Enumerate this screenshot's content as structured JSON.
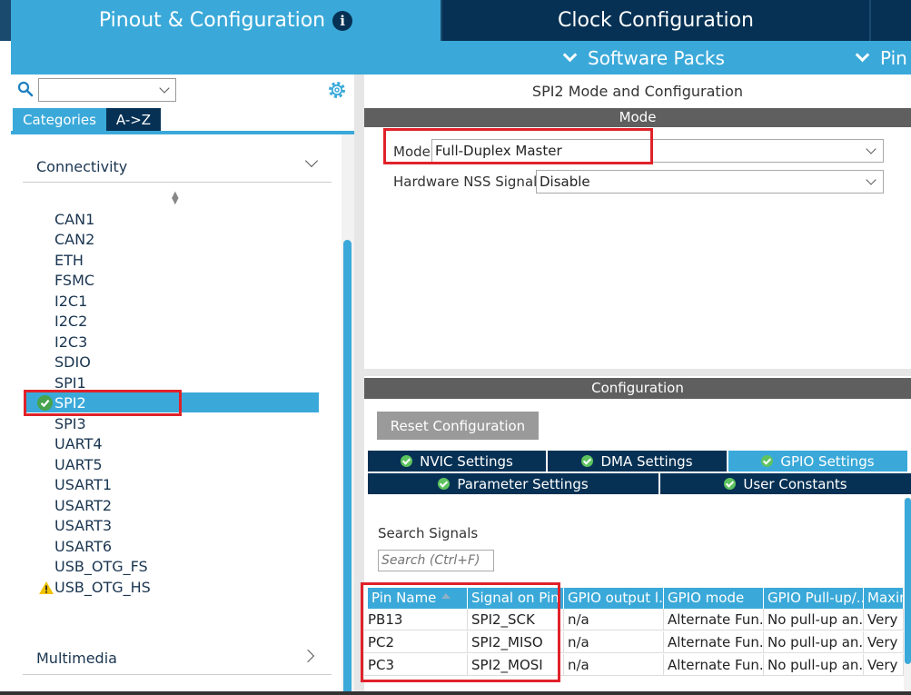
{
  "top_tabs": {
    "pinout": "Pinout & Configuration",
    "clock": "Clock Configuration",
    "info_icon": "i"
  },
  "sub_bar": {
    "software_packs": "Software Packs",
    "pin": "Pin"
  },
  "left": {
    "search_value": "",
    "tabs": [
      "Categories",
      "A->Z"
    ],
    "sections": {
      "connectivity": "Connectivity",
      "multimedia": "Multimedia"
    },
    "peripherals": [
      "CAN1",
      "CAN2",
      "ETH",
      "FSMC",
      "I2C1",
      "I2C2",
      "I2C3",
      "SDIO",
      "SPI1",
      "SPI2",
      "SPI3",
      "UART4",
      "UART5",
      "USART1",
      "USART2",
      "USART3",
      "USART6",
      "USB_OTG_FS",
      "USB_OTG_HS"
    ],
    "selected": "SPI2",
    "configured": [
      "SPI2"
    ],
    "warning": [
      "USB_OTG_HS"
    ]
  },
  "right": {
    "title": "SPI2 Mode and Configuration",
    "mode_header": "Mode",
    "mode_label": "Mode",
    "mode_value": "Full-Duplex Master",
    "nss_label": "Hardware NSS Signal",
    "nss_value": "Disable",
    "config_header": "Configuration",
    "reset_button": "Reset Configuration",
    "tabs_row1": [
      "NVIC Settings",
      "DMA Settings",
      "GPIO Settings"
    ],
    "tabs_row2": [
      "Parameter Settings",
      "User Constants"
    ],
    "active_tab": "GPIO Settings",
    "search_label": "Search Signals",
    "search_placeholder": "Search (Ctrl+F)",
    "table": {
      "columns": [
        "Pin Name",
        "Signal on Pin",
        "GPIO output l...",
        "GPIO mode",
        "GPIO Pull-up/...",
        "Maxim"
      ],
      "rows": [
        [
          "PB13",
          "SPI2_SCK",
          "n/a",
          "Alternate Fun...",
          "No pull-up an...",
          "Very H"
        ],
        [
          "PC2",
          "SPI2_MISO",
          "n/a",
          "Alternate Fun...",
          "No pull-up an...",
          "Very H"
        ],
        [
          "PC3",
          "SPI2_MOSI",
          "n/a",
          "Alternate Fun...",
          "No pull-up an...",
          "Very H"
        ]
      ]
    }
  },
  "colors": {
    "accent_blue": "#3aa9d9",
    "navy": "#063154",
    "highlight_red": "#e0222a",
    "check_green": "#47a34d"
  }
}
